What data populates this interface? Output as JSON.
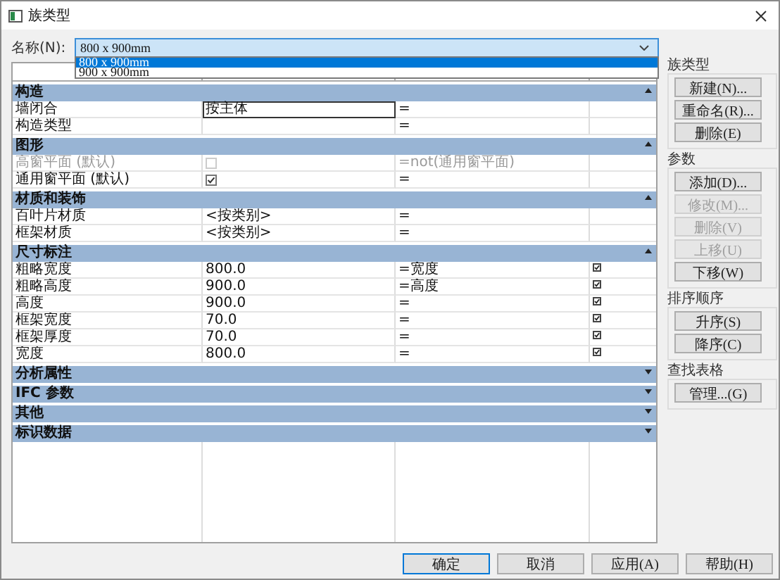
{
  "window": {
    "title": "族类型"
  },
  "name_field": {
    "label": "名称(N):",
    "value": "800 x 900mm",
    "options": [
      {
        "label": "800 x 900mm",
        "selected": true
      },
      {
        "label": "900 x 900mm",
        "selected": false
      }
    ]
  },
  "table": {
    "sections": [
      {
        "title": "构造",
        "expanded": true,
        "rows": [
          {
            "parameter": "墙闭合",
            "kind": "text",
            "value": "按主体",
            "formula": "=",
            "locked": false,
            "disabled": false,
            "selected": true
          },
          {
            "parameter": "构造类型",
            "kind": "text",
            "formula": "=",
            "locked": false,
            "disabled": false,
            "selected": false
          }
        ]
      },
      {
        "title": "图形",
        "expanded": true,
        "rows": [
          {
            "parameter": "高窗平面 (默认)",
            "kind": "checkbox",
            "checked": false,
            "formula": "=not(通用窗平面)",
            "locked": false,
            "disabled": true,
            "selected": false
          },
          {
            "parameter": "通用窗平面 (默认)",
            "kind": "checkbox",
            "checked": true,
            "formula": "=",
            "locked": false,
            "disabled": false,
            "selected": false
          }
        ]
      },
      {
        "title": "材质和装饰",
        "expanded": true,
        "rows": [
          {
            "parameter": "百叶片材质",
            "kind": "text",
            "value": "<按类别>",
            "formula": "=",
            "locked": false,
            "disabled": false,
            "selected": false
          },
          {
            "parameter": "框架材质",
            "kind": "text",
            "value": "<按类别>",
            "formula": "=",
            "locked": false,
            "disabled": false,
            "selected": false
          }
        ]
      },
      {
        "title": "尺寸标注",
        "expanded": true,
        "rows": [
          {
            "parameter": "粗略宽度",
            "kind": "text",
            "value": "800.0",
            "formula": "=宽度",
            "locked": true,
            "disabled": false,
            "selected": false
          },
          {
            "parameter": "粗略高度",
            "kind": "text",
            "value": "900.0",
            "formula": "=高度",
            "locked": true,
            "disabled": false,
            "selected": false
          },
          {
            "parameter": "高度",
            "kind": "text",
            "value": "900.0",
            "formula": "=",
            "locked": true,
            "disabled": false,
            "selected": false
          },
          {
            "parameter": "框架宽度",
            "kind": "text",
            "value": "70.0",
            "formula": "=",
            "locked": true,
            "disabled": false,
            "selected": false
          },
          {
            "parameter": "框架厚度",
            "kind": "text",
            "value": "70.0",
            "formula": "=",
            "locked": true,
            "disabled": false,
            "selected": false
          },
          {
            "parameter": "宽度",
            "kind": "text",
            "value": "800.0",
            "formula": "=",
            "locked": true,
            "disabled": false,
            "selected": false
          }
        ]
      },
      {
        "title": "分析属性",
        "expanded": false
      },
      {
        "title": "IFC 参数",
        "expanded": false
      },
      {
        "title": "其他",
        "expanded": false
      },
      {
        "title": "标识数据",
        "expanded": false
      }
    ]
  },
  "side_groups": [
    {
      "title": "族类型",
      "buttons": [
        {
          "label": "新建(N)...",
          "disabled": false
        },
        {
          "label": "重命名(R)...",
          "disabled": false
        },
        {
          "label": "删除(E)",
          "disabled": false
        }
      ]
    },
    {
      "title": "参数",
      "buttons": [
        {
          "label": "添加(D)...",
          "disabled": false
        },
        {
          "label": "修改(M)...",
          "disabled": true
        },
        {
          "label": "删除(V)",
          "disabled": true
        },
        {
          "label": "上移(U)",
          "disabled": true
        },
        {
          "label": "下移(W)",
          "disabled": false
        }
      ]
    },
    {
      "title": "排序顺序",
      "buttons": [
        {
          "label": "升序(S)",
          "disabled": false
        },
        {
          "label": "降序(C)",
          "disabled": false
        }
      ]
    },
    {
      "title": "查找表格",
      "buttons": [
        {
          "label": "管理...(G)",
          "disabled": false
        }
      ]
    }
  ],
  "footer_buttons": [
    {
      "label": "确定",
      "default": true
    },
    {
      "label": "取消",
      "default": false
    },
    {
      "label": "应用(A)",
      "default": false
    },
    {
      "label": "帮助(H)",
      "default": false
    }
  ]
}
